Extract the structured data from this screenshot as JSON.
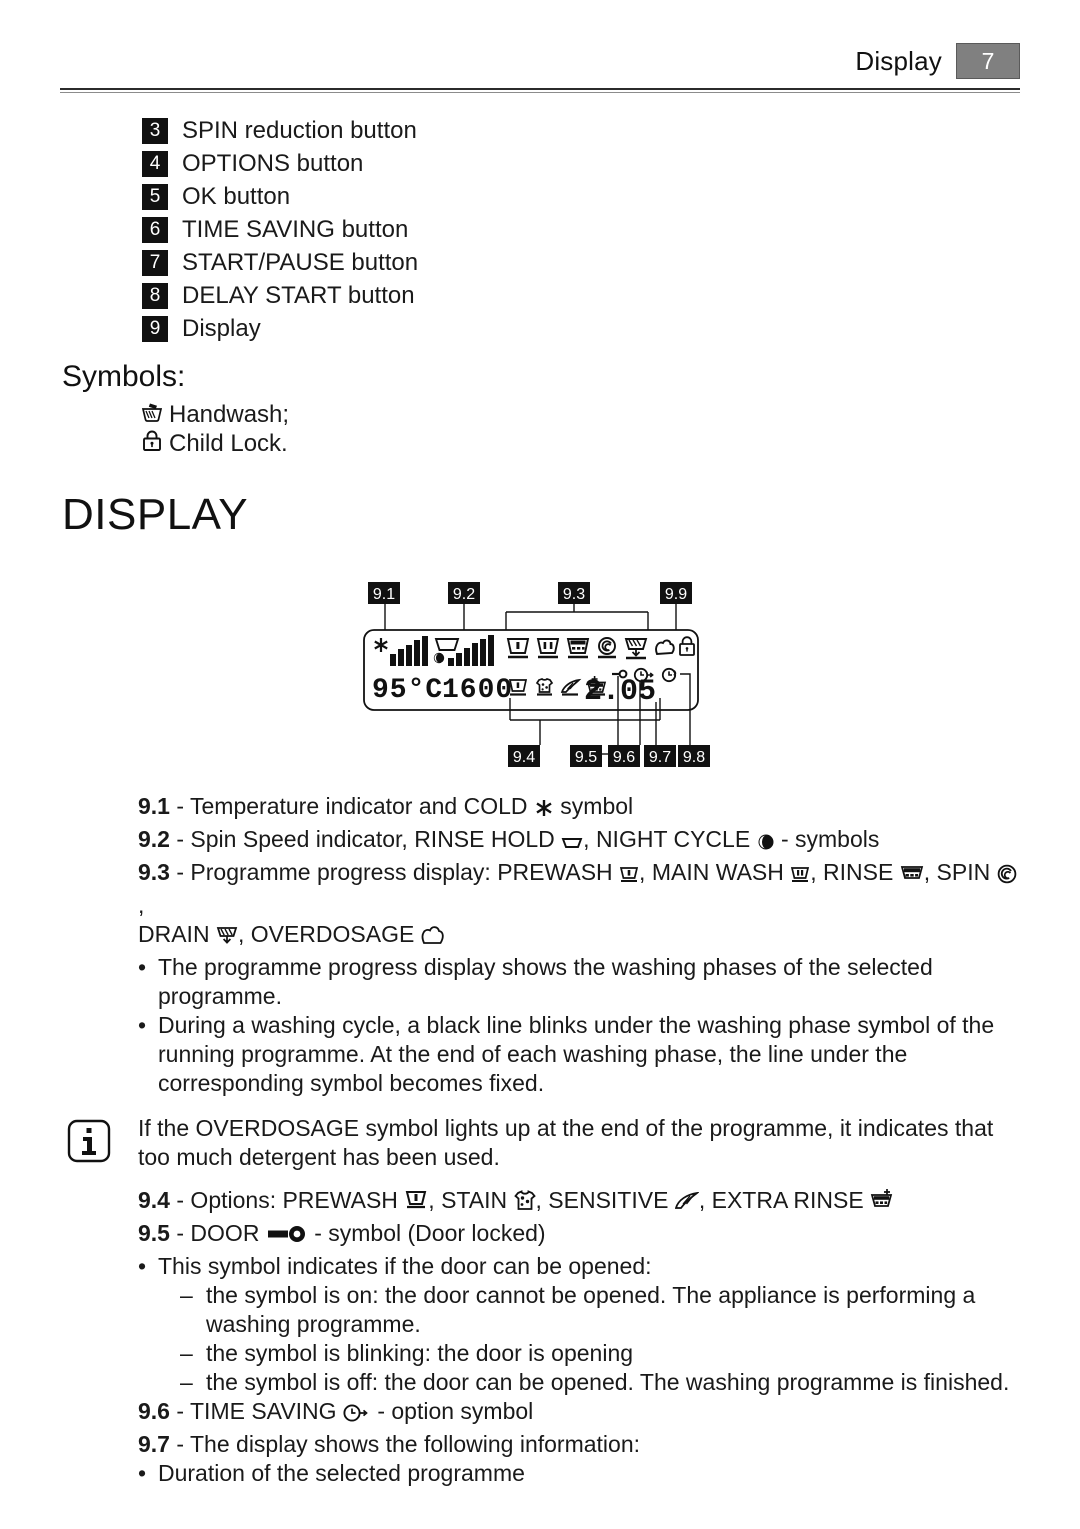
{
  "header": {
    "title": "Display",
    "page_number": "7"
  },
  "numbered_list": [
    {
      "num": "3",
      "label": "SPIN reduction button"
    },
    {
      "num": "4",
      "label": "OPTIONS button"
    },
    {
      "num": "5",
      "label": "OK button"
    },
    {
      "num": "6",
      "label": "TIME SAVING button"
    },
    {
      "num": "7",
      "label": "START/PAUSE button"
    },
    {
      "num": "8",
      "label": "DELAY START button"
    },
    {
      "num": "9",
      "label": "Display"
    }
  ],
  "symbols": {
    "heading": "Symbols:",
    "items": [
      {
        "icon": "handwash-icon",
        "label": "Handwash;"
      },
      {
        "icon": "child-lock-icon",
        "label": "Child Lock."
      }
    ]
  },
  "display_section": {
    "title": "DISPLAY",
    "lcd": {
      "temperature_value": "95°C",
      "spin_speed_value": "1600",
      "time_value": "2.05",
      "temperature_bars": 5,
      "spin_bars": 6,
      "cold_icon": "snowflake-icon",
      "rinse_hold_icon": "rinse-hold-tub-icon",
      "night_cycle_icon": "night-cycle-moon-icon",
      "progress_icons": [
        "prewash-icon",
        "main-wash-icon",
        "rinse-icon",
        "spin-icon",
        "drain-icon",
        "overdosage-icon"
      ],
      "child_lock_icon": "child-lock-icon",
      "option_icons": [
        "prewash-icon",
        "stain-icon",
        "sensitive-icon",
        "extra-rinse-icon"
      ],
      "door_lock_icon": "door-key-icon",
      "time_saving_icon": "time-saving-clock-icon",
      "delay_start_icon": "delay-start-clock-icon"
    },
    "callouts_top": [
      "9.1",
      "9.2",
      "9.3",
      "9.9"
    ],
    "callouts_bottom": [
      "9.4",
      "9.5",
      "9.6",
      "9.7",
      "9.8"
    ]
  },
  "descriptions": {
    "d91": {
      "num": "9.1",
      "text_before": " - Temperature indicator and COLD ",
      "text_after": " symbol"
    },
    "d92": {
      "num": "9.2",
      "t1": " - Spin Speed indicator, RINSE HOLD ",
      "t2": ", NIGHT CYCLE ",
      "t3": " - symbols"
    },
    "d93": {
      "num": "9.3",
      "t1": " - Programme progress display: PREWASH ",
      "t2": ", MAIN WASH ",
      "t3": ", RINSE ",
      "t4": ", SPIN ",
      "t5": ",",
      "t6": "DRAIN ",
      "t7": ", OVERDOSAGE "
    },
    "bullets_93": [
      "The programme progress display shows the washing phases of the selected programme.",
      "During a washing cycle, a black line blinks under the washing phase symbol of the running programme. At the end of each washing phase, the line under the corresponding symbol becomes fixed."
    ],
    "note": "If the OVERDOSAGE symbol lights up at the end of the programme, it indicates that too much detergent has been used.",
    "d94": {
      "num": "9.4",
      "t1": " - Options: PREWASH ",
      "t2": ", STAIN ",
      "t3": ", SENSITIVE ",
      "t4": ", EXTRA RINSE "
    },
    "d95": {
      "num": "9.5",
      "t1": " - DOOR ",
      "t2": " - symbol (Door locked)"
    },
    "bullet_95": "This symbol indicates if the door can be opened:",
    "dashes_95": [
      "the symbol is on: the door cannot be opened. The appliance is performing a washing programme.",
      "the symbol is blinking: the door is opening",
      "the symbol is off: the door can be opened. The washing programme is finished."
    ],
    "d96": {
      "num": "9.6",
      "t1": " - TIME SAVING ",
      "t2": " - option symbol"
    },
    "d97": {
      "num": "9.7",
      "text": " - The display shows the following information:"
    },
    "bullet_97": "Duration of the selected programme"
  },
  "colors": {
    "page_box_bg": "#808080",
    "num_box_bg": "#111111",
    "text": "#1a1a1a"
  }
}
